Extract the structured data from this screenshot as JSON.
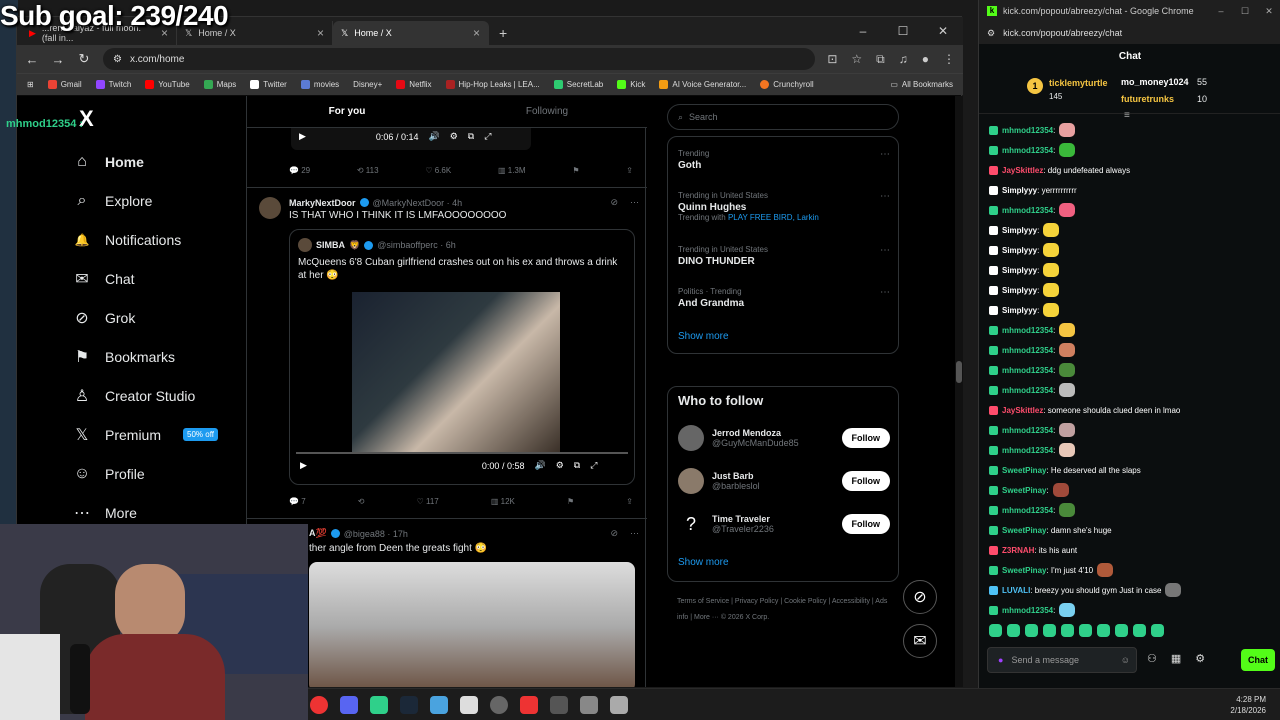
{
  "overlay": {
    "sub_goal": "Sub goal: 239/240",
    "chat_user": "mhmod12354 :"
  },
  "browser": {
    "tabs": [
      {
        "label": "...rent Faiyaz - full moon. (fall in..."
      },
      {
        "label": "Home / X"
      },
      {
        "label": "Home / X"
      }
    ],
    "new_tab": "+",
    "url": "x.com/home",
    "bookmarks": [
      {
        "label": "Gmail",
        "color": "#ea4335"
      },
      {
        "label": "Twitch",
        "color": "#9146ff"
      },
      {
        "label": "YouTube",
        "color": "#ff0000"
      },
      {
        "label": "Maps",
        "color": "#34a853"
      },
      {
        "label": "Twitter",
        "color": "#ffffff"
      },
      {
        "label": "movies",
        "color": "#5b7bd5"
      },
      {
        "label": "Disney+",
        "color": "#113ccf"
      },
      {
        "label": "Netflix",
        "color": "#e50914"
      },
      {
        "label": "Hip-Hop Leaks | LEA...",
        "color": "#aa2222"
      },
      {
        "label": "SecretLab",
        "color": "#2ecc71"
      },
      {
        "label": "Kick",
        "color": "#53fc18"
      },
      {
        "label": "AI Voice Generator...",
        "color": "#f39c12"
      },
      {
        "label": "Crunchyroll",
        "color": "#f47521"
      }
    ],
    "all_bookmarks": "All Bookmarks"
  },
  "x_nav": {
    "logo": "X",
    "items": [
      {
        "label": "Home",
        "icon": "home-icon",
        "glyph": "⌂"
      },
      {
        "label": "Explore",
        "icon": "search-icon",
        "glyph": "⌕"
      },
      {
        "label": "Notifications",
        "icon": "bell-icon",
        "glyph": "🔔"
      },
      {
        "label": "Chat",
        "icon": "mail-icon",
        "glyph": "✉"
      },
      {
        "label": "Grok",
        "icon": "grok-icon",
        "glyph": "⊘"
      },
      {
        "label": "Bookmarks",
        "icon": "bookmark-icon",
        "glyph": "⚑"
      },
      {
        "label": "Creator Studio",
        "icon": "creator-icon",
        "glyph": "♙"
      },
      {
        "label": "Premium",
        "icon": "x-premium-icon",
        "glyph": "𝕏"
      },
      {
        "label": "Profile",
        "icon": "profile-icon",
        "glyph": "☺"
      },
      {
        "label": "More",
        "icon": "more-icon",
        "glyph": "⋯"
      }
    ],
    "premium_badge": "50% off"
  },
  "timeline": {
    "tabs": {
      "for_you": "For you",
      "following": "Following"
    },
    "top_video": {
      "time": "0:06 / 0:14"
    },
    "top_actions": {
      "replies": "29",
      "reposts": "113",
      "likes": "6.6K",
      "views": "1.3M"
    },
    "tweet1": {
      "name": "MarkyNextDoor",
      "handle": "@MarkyNextDoor · 4h",
      "text": "IS THAT WHO I THINK IT IS LMFAOOOOOOOO",
      "quote_name": "SIMBA",
      "quote_handle": "@simbaoffperc · 6h",
      "quote_text": "McQueens 6'8 Cuban girlfriend crashes out on his ex and throws a drink at her 😳",
      "video_time": "0:00 / 0:58",
      "replies": "7",
      "reposts": "",
      "likes": "117",
      "views": "12K"
    },
    "tweet2": {
      "name": "A💯",
      "handle": "@bigea88 · 17h",
      "text": "ther angle from Deen the greats fight 😳"
    }
  },
  "right": {
    "search_placeholder": "Search",
    "trends": [
      {
        "context": "Trending",
        "title": "Goth",
        "with": ""
      },
      {
        "context": "Trending in United States",
        "title": "Quinn Hughes",
        "with": "Trending with PLAY FREE BIRD, Larkin"
      },
      {
        "context": "Trending in United States",
        "title": "DINO THUNDER",
        "with": ""
      },
      {
        "context": "Politics · Trending",
        "title": "And Grandma",
        "with": ""
      }
    ],
    "show_more": "Show more",
    "who_to_follow": "Who to follow",
    "follow_list": [
      {
        "name": "Jerrod Mendoza",
        "handle": "@GuyMcManDude85"
      },
      {
        "name": "Just Barb",
        "handle": "@barbleslol"
      },
      {
        "name": "Time Traveler",
        "handle": "@Traveler2236"
      }
    ],
    "follow_label": "Follow",
    "footer": "Terms of Service | Privacy Policy | Cookie Policy | Accessibility | Ads info | More ··· © 2026 X Corp."
  },
  "taskbar": {
    "time": "4:28 PM",
    "date": "2/18/2026"
  },
  "kick": {
    "window_title": "kick.com/popout/abreezy/chat - Google Chrome",
    "url": "kick.com/popout/abreezy/chat",
    "chat_title": "Chat",
    "gifters": [
      {
        "name": "ticklemyturtle",
        "count": "145"
      },
      {
        "name": "mo_money1024",
        "count": "55"
      },
      {
        "name": "futuretrunks",
        "count": "10"
      }
    ],
    "messages": [
      {
        "user": "mhmod12354",
        "text": ":",
        "color": "#2fd08a",
        "emote": "#e8a0a0"
      },
      {
        "user": "mhmod12354",
        "text": ":",
        "color": "#2fd08a",
        "emote": "#3ab83a"
      },
      {
        "user": "JaySkittlez",
        "text": ": ddg undefeated always",
        "color": "#ff4d6d",
        "emote": ""
      },
      {
        "user": "Simplyyy",
        "text": ": yerrrrrrrrrr",
        "color": "#ffffff",
        "emote": ""
      },
      {
        "user": "mhmod12354",
        "text": ":",
        "color": "#2fd08a",
        "emote": "#f06080"
      },
      {
        "user": "Simplyyy",
        "text": ":",
        "color": "#ffffff",
        "emote": "#f5d33a"
      },
      {
        "user": "Simplyyy",
        "text": ":",
        "color": "#ffffff",
        "emote": "#f5d33a"
      },
      {
        "user": "Simplyyy",
        "text": ":",
        "color": "#ffffff",
        "emote": "#f5d33a"
      },
      {
        "user": "Simplyyy",
        "text": ":",
        "color": "#ffffff",
        "emote": "#f5d33a"
      },
      {
        "user": "Simplyyy",
        "text": ":",
        "color": "#ffffff",
        "emote": "#f5d33a"
      },
      {
        "user": "mhmod12354",
        "text": ":",
        "color": "#2fd08a",
        "emote": "#f5c542"
      },
      {
        "user": "mhmod12354",
        "text": ":",
        "color": "#2fd08a",
        "emote": "#d08060"
      },
      {
        "user": "mhmod12354",
        "text": ":",
        "color": "#2fd08a",
        "emote": "#4a8a3a"
      },
      {
        "user": "mhmod12354",
        "text": ":",
        "color": "#2fd08a",
        "emote": "#bbbbbb"
      },
      {
        "user": "JaySkittlez",
        "text": ": someone shoulda clued deen in lmao",
        "color": "#ff4d6d",
        "emote": ""
      },
      {
        "user": "mhmod12354",
        "text": ":",
        "color": "#2fd08a",
        "emote": "#c0a0a0"
      },
      {
        "user": "mhmod12354",
        "text": ":",
        "color": "#2fd08a",
        "emote": "#e8c8b8"
      },
      {
        "user": "SweetPinay",
        "text": ": He deserved all the slaps",
        "color": "#2fd08a",
        "emote": ""
      },
      {
        "user": "SweetPinay",
        "text": ":",
        "color": "#2fd08a",
        "emote": "#a04a3a"
      },
      {
        "user": "mhmod12354",
        "text": ":",
        "color": "#2fd08a",
        "emote": "#4a8a3a"
      },
      {
        "user": "SweetPinay",
        "text": ": damn she's huge",
        "color": "#2fd08a",
        "emote": ""
      },
      {
        "user": "Z3RNAH",
        "text": ": its his aunt",
        "color": "#ff4d6d",
        "emote": ""
      },
      {
        "user": "SweetPinay",
        "text": ": I'm just 4'10",
        "color": "#2fd08a",
        "emote": "#b05a3a"
      },
      {
        "user": "LUVALI",
        "text": ": breezy you should gym Just in case",
        "color": "#4fc3f7",
        "emote": "#777777"
      },
      {
        "user": "mhmod12354",
        "text": ":",
        "color": "#2fd08a",
        "emote": "#7ad0f0"
      }
    ],
    "input_placeholder": "Send a message",
    "chat_button": "Chat"
  }
}
